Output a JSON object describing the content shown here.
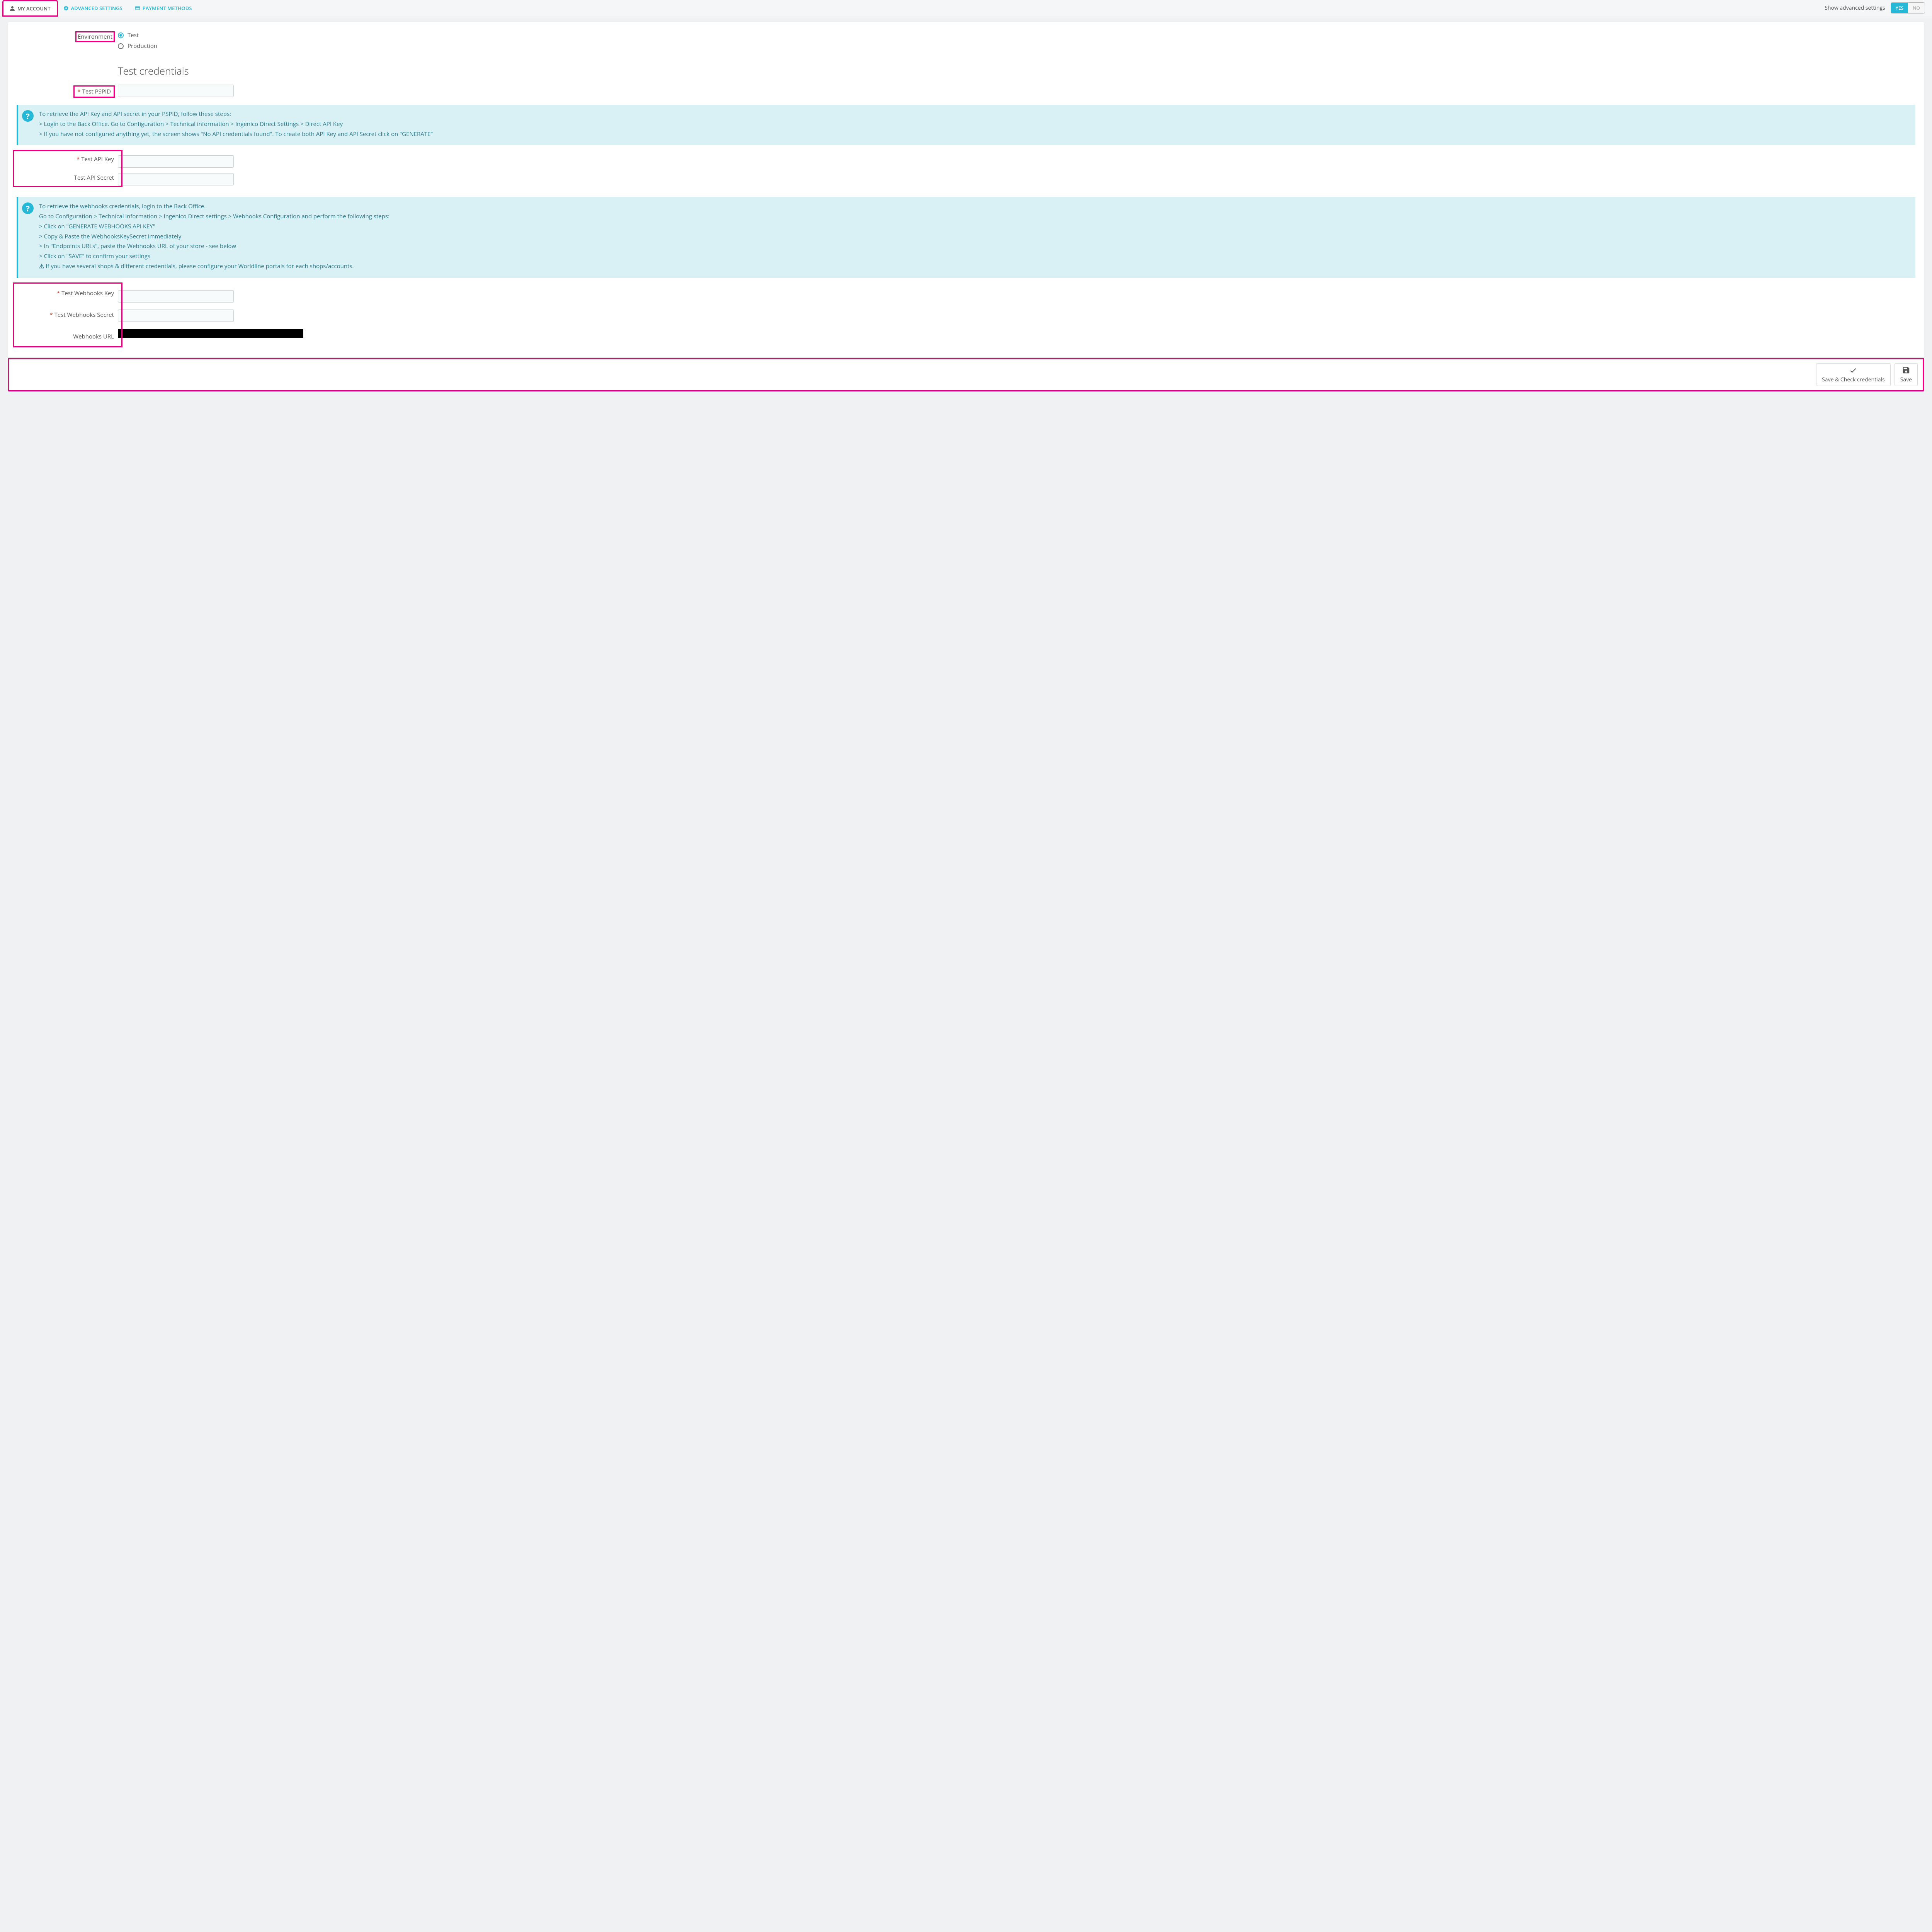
{
  "tabs": {
    "my_account": "MY ACCOUNT",
    "advanced_settings": "ADVANCED SETTINGS",
    "payment_methods": "PAYMENT METHODS"
  },
  "advanced_toggle": {
    "label": "Show advanced settings",
    "yes": "YES",
    "no": "NO"
  },
  "environment": {
    "label": "Environment",
    "opt_test": "Test",
    "opt_production": "Production"
  },
  "section_heading": "Test credentials",
  "fields": {
    "test_pspid": "Test PSPID",
    "test_api_key": "Test API Key",
    "test_api_secret": "Test API Secret",
    "test_webhooks_key": "Test Webhooks Key",
    "test_webhooks_secret": "Test Webhooks Secret",
    "webhooks_url": "Webhooks URL"
  },
  "help_api": {
    "line1": "To retrieve the API Key and API secret in your PSPID, follow these steps:",
    "line2": "> Login to the Back Office. Go to Configuration > Technical information > Ingenico Direct Settings > Direct API Key",
    "line3": "> If you have not configured anything yet, the screen shows \"No API credentials found\". To create both API Key and API Secret click on \"GENERATE\""
  },
  "help_webhooks": {
    "line1": "To retrieve the webhooks credentials, login to the Back Office.",
    "line2": "Go to Configuration > Technical information > Ingenico Direct settings > Webhooks Configuration and perform the following steps:",
    "line3": "> Click on \"GENERATE WEBHOOKS API KEY\"",
    "line4": "> Copy & Paste the WebhooksKeySecret immediately",
    "line5": "> In \"Endpoints URLs\", paste the Webhooks URL of your store - see below",
    "line6": "> Click on \"SAVE\" to confirm your settings",
    "warn": "If you have several shops & different credentials, please configure your Worldline portals for each shops/accounts."
  },
  "buttons": {
    "save_check": "Save & Check credentials",
    "save": "Save"
  }
}
